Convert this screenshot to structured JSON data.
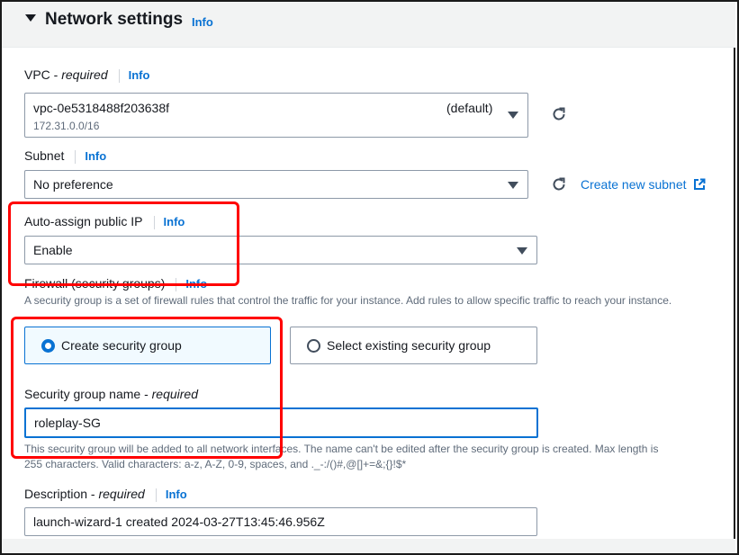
{
  "section": {
    "title": "Network settings",
    "info": "Info"
  },
  "vpc": {
    "label": "VPC - ",
    "required": "required",
    "info": "Info",
    "value": "vpc-0e5318488f203638f",
    "default_tag": "(default)",
    "cidr": "172.31.0.0/16"
  },
  "subnet": {
    "label": "Subnet",
    "info": "Info",
    "value": "No preference",
    "create_link": "Create new subnet"
  },
  "auto_assign": {
    "label": "Auto-assign public IP",
    "info": "Info",
    "value": "Enable"
  },
  "firewall": {
    "label": "Firewall (security groups)",
    "info": "Info",
    "description": "A security group is a set of firewall rules that control the traffic for your instance. Add rules to allow specific traffic to reach your instance.",
    "option_create": "Create security group",
    "option_existing": "Select existing security group",
    "selected": "create"
  },
  "sg_name": {
    "label": "Security group name - ",
    "required": "required",
    "value": "roleplay-SG",
    "help_line1": "This security group will be added to all network interfaces. The name can't be edited after the security group is created. Max length is",
    "help_line2": "255 characters. Valid characters: a-z, A-Z, 0-9, spaces, and ._-:/()#,@[]+=&;{}!$*"
  },
  "description": {
    "label": "Description - ",
    "required": "required",
    "info": "Info",
    "value": "launch-wizard-1 created 2024-03-27T13:45:46.956Z"
  },
  "colors": {
    "accent": "#0972d3",
    "highlight": "#ff0000",
    "header_bg": "#f2f3f3"
  },
  "icons": {
    "caret": "caret-down-icon",
    "refresh": "refresh-icon",
    "external": "external-link-icon"
  }
}
